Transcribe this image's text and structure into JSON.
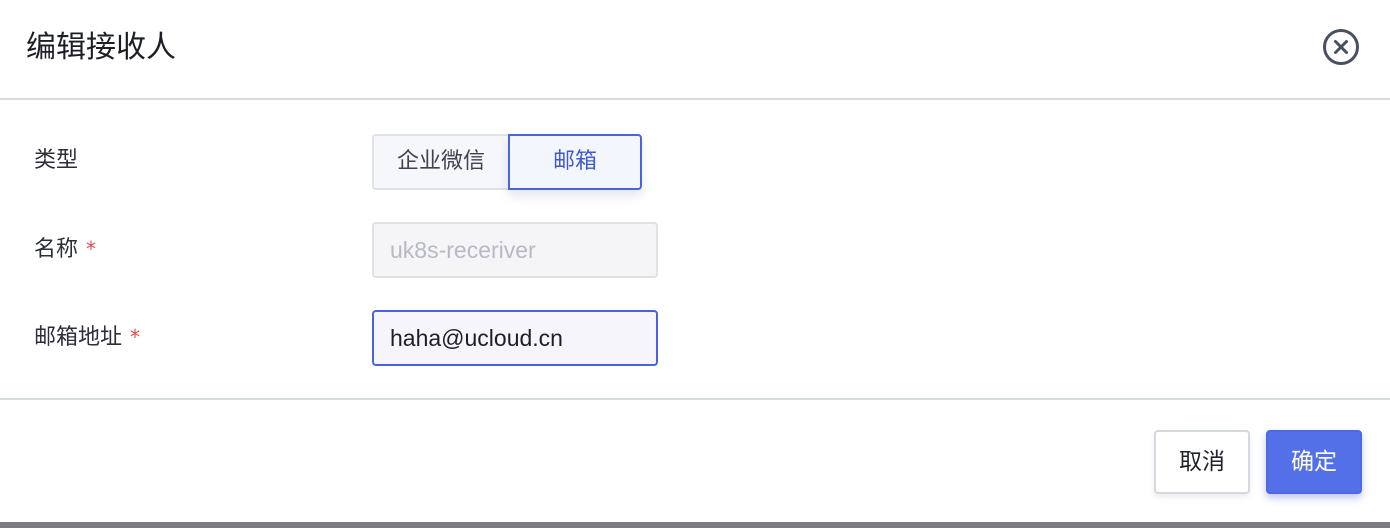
{
  "dialog": {
    "title": "编辑接收人",
    "close_icon": "close-circle-icon"
  },
  "form": {
    "type": {
      "label": "类型",
      "options": [
        "企业微信",
        "邮箱"
      ],
      "selected": "邮箱"
    },
    "name": {
      "label": "名称",
      "required_mark": "*",
      "value": "uk8s-receriver",
      "disabled": true
    },
    "email": {
      "label": "邮箱地址",
      "required_mark": "*",
      "value": "haha@ucloud.cn"
    }
  },
  "footer": {
    "cancel_label": "取消",
    "confirm_label": "确定"
  },
  "colors": {
    "accent": "#4d64d8",
    "primary_button": "#5470e8",
    "required": "#e5484d"
  }
}
